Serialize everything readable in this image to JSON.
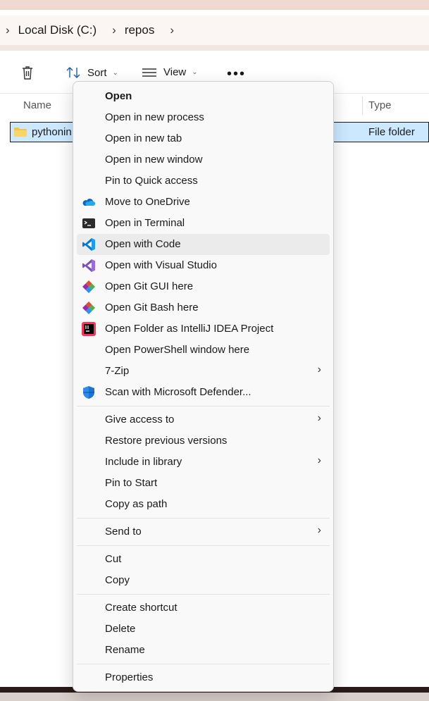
{
  "breadcrumb": {
    "items": [
      "Local Disk (C:)",
      "repos"
    ]
  },
  "toolbar": {
    "sort_label": "Sort",
    "view_label": "View"
  },
  "columns": {
    "name": "Name",
    "type": "Type"
  },
  "selected_row": {
    "name": "pythonin",
    "type": "File folder"
  },
  "context_menu": {
    "items": [
      {
        "label": "Open",
        "icon": "none",
        "bold": true
      },
      {
        "label": "Open in new process",
        "icon": "none"
      },
      {
        "label": "Open in new tab",
        "icon": "none"
      },
      {
        "label": "Open in new window",
        "icon": "none"
      },
      {
        "label": "Pin to Quick access",
        "icon": "none"
      },
      {
        "label": "Move to OneDrive",
        "icon": "onedrive-icon"
      },
      {
        "label": "Open in Terminal",
        "icon": "terminal-icon"
      },
      {
        "label": "Open with Code",
        "icon": "vscode-icon",
        "hovered": true
      },
      {
        "label": "Open with Visual Studio",
        "icon": "visual-studio-icon"
      },
      {
        "label": "Open Git GUI here",
        "icon": "git-icon"
      },
      {
        "label": "Open Git Bash here",
        "icon": "git-icon"
      },
      {
        "label": "Open Folder as IntelliJ IDEA Project",
        "icon": "intellij-icon"
      },
      {
        "label": "Open PowerShell window here",
        "icon": "none"
      },
      {
        "label": "7-Zip",
        "icon": "none",
        "submenu": true
      },
      {
        "label": "Scan with Microsoft Defender...",
        "icon": "defender-icon"
      },
      {
        "label": "Give access to",
        "icon": "none",
        "submenu": true
      },
      {
        "label": "Restore previous versions",
        "icon": "none"
      },
      {
        "label": "Include in library",
        "icon": "none",
        "submenu": true
      },
      {
        "label": "Pin to Start",
        "icon": "none"
      },
      {
        "label": "Copy as path",
        "icon": "none"
      },
      {
        "label": "Send to",
        "icon": "none",
        "submenu": true
      },
      {
        "label": "Cut",
        "icon": "none"
      },
      {
        "label": "Copy",
        "icon": "none"
      },
      {
        "label": "Create shortcut",
        "icon": "none"
      },
      {
        "label": "Delete",
        "icon": "none"
      },
      {
        "label": "Rename",
        "icon": "none"
      },
      {
        "label": "Properties",
        "icon": "none"
      }
    ]
  },
  "colors": {
    "selection": "#cce8ff",
    "menu_bg": "#f9f9f9",
    "hover_bg": "#ebebeb",
    "folder": "#f4c542",
    "vscode": "#0078d4",
    "visual_studio": "#7b4fbf"
  }
}
